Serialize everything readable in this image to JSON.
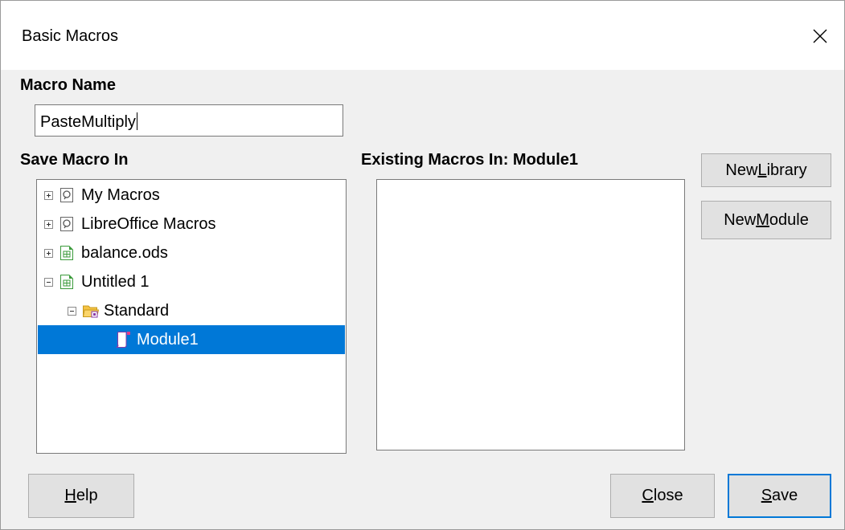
{
  "window": {
    "title": "Basic Macros"
  },
  "macro_name": {
    "label": "Macro Name",
    "value": "PasteMultiply"
  },
  "save_macro_in": {
    "label": "Save Macro In",
    "tree": [
      {
        "label": "My Macros",
        "expander": "plus",
        "icon": "macro-library-icon"
      },
      {
        "label": "LibreOffice Macros",
        "expander": "plus",
        "icon": "macro-library-icon"
      },
      {
        "label": "balance.ods",
        "expander": "plus",
        "icon": "spreadsheet-icon"
      },
      {
        "label": "Untitled 1",
        "expander": "minus",
        "icon": "spreadsheet-icon"
      },
      {
        "label": "Standard",
        "expander": "minus",
        "icon": "folder-icon"
      },
      {
        "label": "Module1",
        "expander": "none",
        "icon": "module-icon",
        "selected": true
      }
    ]
  },
  "existing_macros": {
    "label": "Existing Macros In: Module1",
    "items": []
  },
  "buttons": {
    "new_library": {
      "pre": "New ",
      "mnemonic": "L",
      "post": "ibrary"
    },
    "new_module": {
      "pre": "New ",
      "mnemonic": "M",
      "post": "odule"
    },
    "help": {
      "pre": "",
      "mnemonic": "H",
      "post": "elp"
    },
    "close": {
      "pre": "",
      "mnemonic": "C",
      "post": "lose"
    },
    "save": {
      "pre": "",
      "mnemonic": "S",
      "post": "ave"
    }
  },
  "colors": {
    "selection": "#0078d7",
    "default_button_border": "#0078d7"
  }
}
